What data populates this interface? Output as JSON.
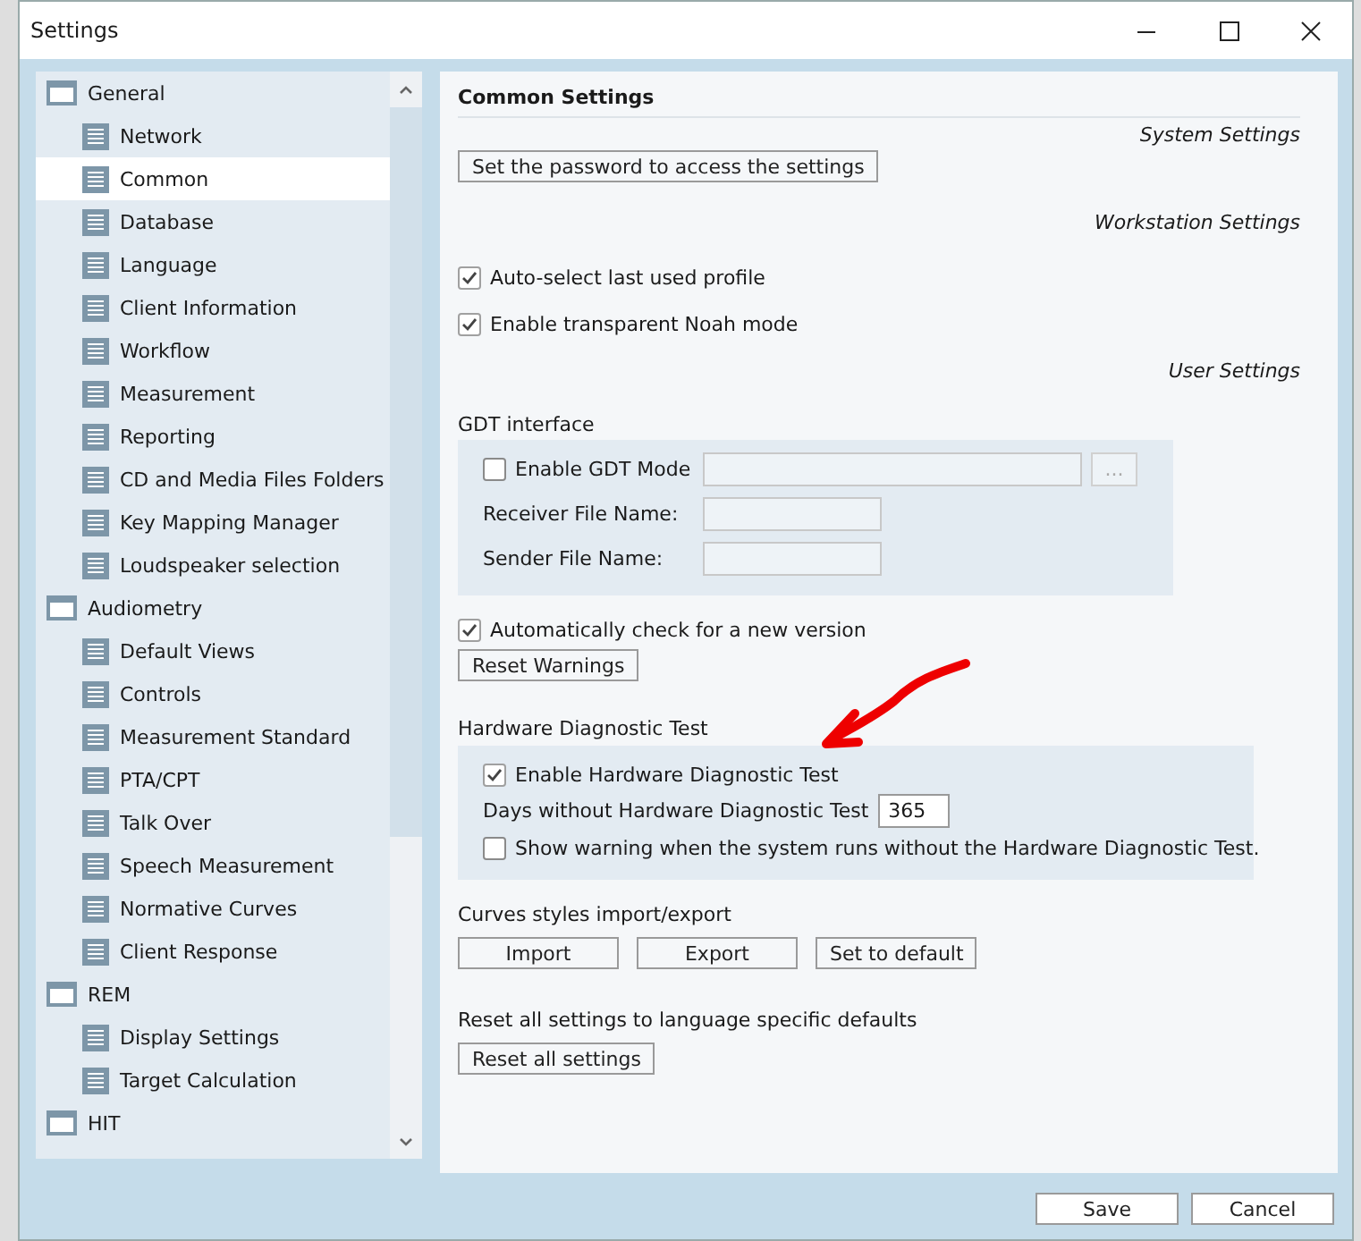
{
  "window": {
    "title": "Settings"
  },
  "sidebar": {
    "items": [
      {
        "label": "General",
        "selected": false,
        "children": [
          {
            "label": "Network",
            "selected": false
          },
          {
            "label": "Common",
            "selected": true
          },
          {
            "label": "Database",
            "selected": false
          },
          {
            "label": "Language",
            "selected": false
          },
          {
            "label": "Client Information",
            "selected": false
          },
          {
            "label": "Workflow",
            "selected": false
          },
          {
            "label": "Measurement",
            "selected": false
          },
          {
            "label": "Reporting",
            "selected": false
          },
          {
            "label": "CD and Media Files Folders",
            "selected": false
          },
          {
            "label": "Key Mapping Manager",
            "selected": false
          },
          {
            "label": "Loudspeaker selection",
            "selected": false
          }
        ]
      },
      {
        "label": "Audiometry",
        "selected": false,
        "children": [
          {
            "label": "Default Views",
            "selected": false
          },
          {
            "label": "Controls",
            "selected": false
          },
          {
            "label": "Measurement Standard",
            "selected": false
          },
          {
            "label": "PTA/CPT",
            "selected": false
          },
          {
            "label": "Talk Over",
            "selected": false
          },
          {
            "label": "Speech Measurement",
            "selected": false
          },
          {
            "label": "Normative Curves",
            "selected": false
          },
          {
            "label": "Client Response",
            "selected": false
          }
        ]
      },
      {
        "label": "REM",
        "selected": false,
        "children": [
          {
            "label": "Display Settings",
            "selected": false
          },
          {
            "label": "Target Calculation",
            "selected": false
          }
        ]
      },
      {
        "label": "HIT",
        "selected": false
      }
    ]
  },
  "content": {
    "title": "Common Settings",
    "system_label": "System Settings",
    "password_button": "Set the password to access the settings",
    "workstation_label": "Workstation Settings",
    "workstation_options": [
      {
        "label": "Auto-select last used profile",
        "checked": true
      },
      {
        "label": "Enable transparent Noah mode",
        "checked": true
      }
    ],
    "user_label": "User Settings",
    "gdt": {
      "title": "GDT interface",
      "enable": {
        "label": "Enable GDT Mode",
        "checked": false
      },
      "browse_button": {
        "label": "...",
        "disabled": true
      },
      "fields": [
        {
          "label": "Receiver File Name:"
        },
        {
          "label": "Sender File Name:"
        }
      ]
    },
    "auto_check": {
      "label": "Automatically check for a new version",
      "checked": true
    },
    "reset_warnings_button": "Reset Warnings",
    "hdt": {
      "title": "Hardware Diagnostic Test",
      "enable": {
        "label": "Enable Hardware Diagnostic Test",
        "checked": true
      },
      "days": {
        "label": "Days without Hardware Diagnostic Test",
        "value": "365"
      },
      "warning": {
        "label": "Show warning when the system runs without the Hardware Diagnostic Test.",
        "checked": false
      }
    },
    "curves": {
      "title": "Curves styles import/export",
      "buttons": [
        "Import",
        "Export",
        "Set to default"
      ]
    },
    "reset": {
      "title": "Reset all settings to language specific defaults",
      "button": "Reset all settings"
    }
  },
  "footer": {
    "buttons": [
      "Save",
      "Cancel"
    ]
  }
}
